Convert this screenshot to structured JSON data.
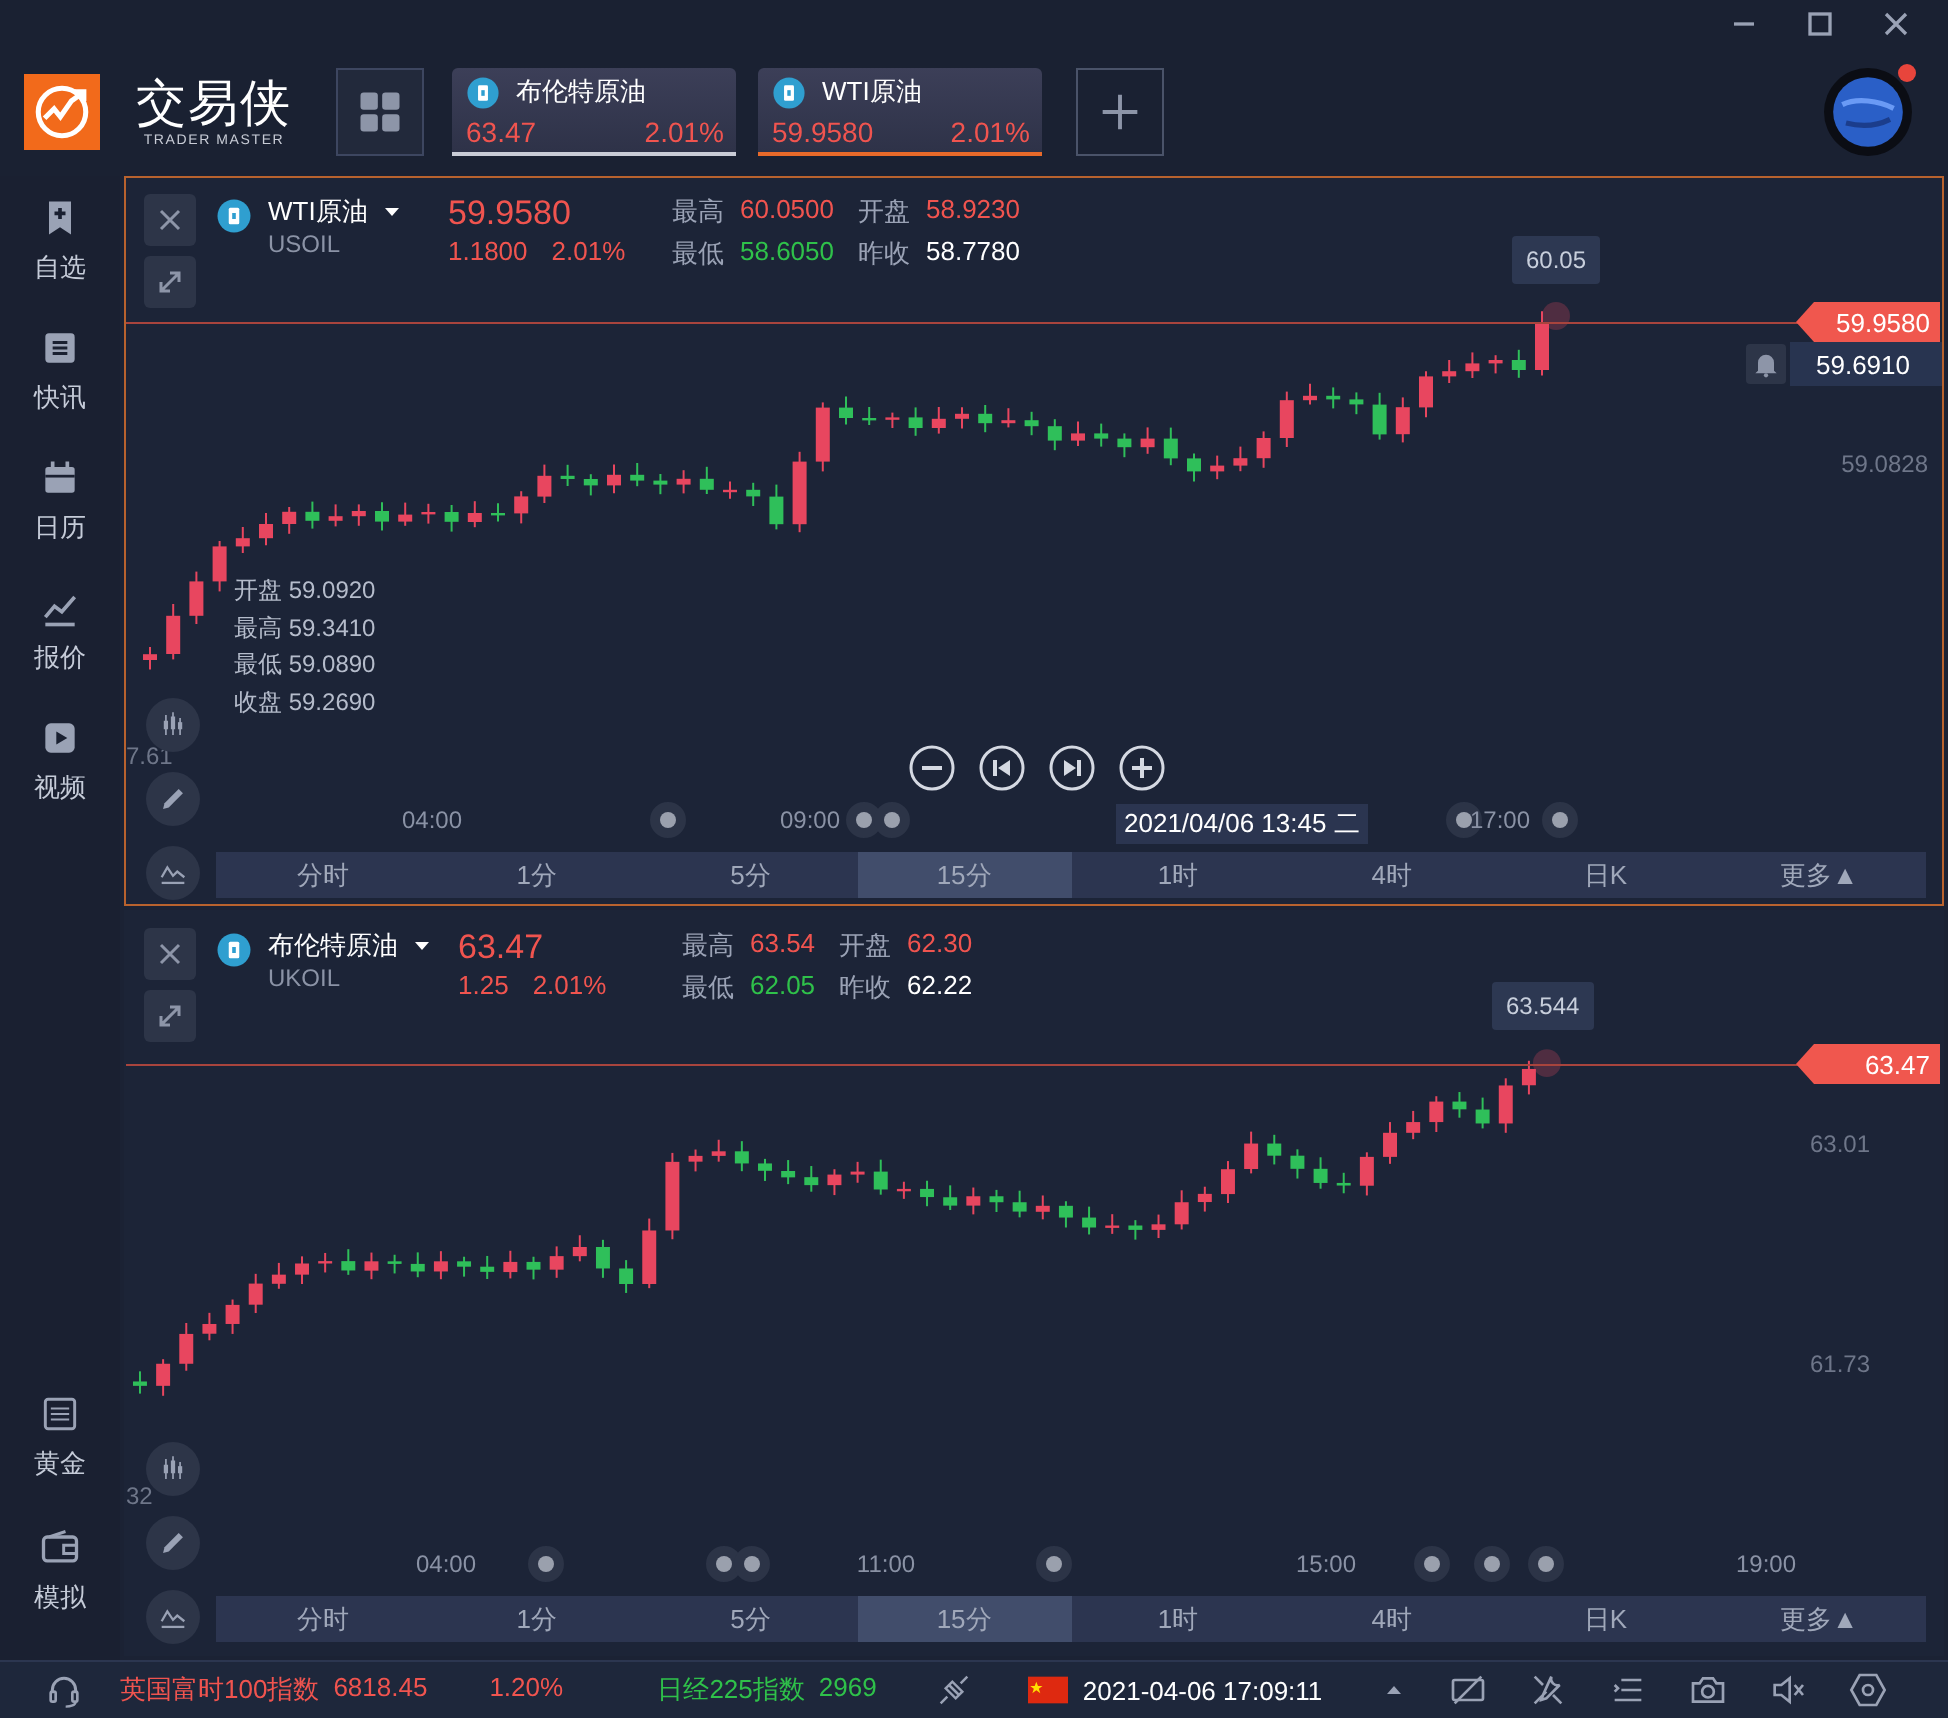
{
  "window_controls": [
    {
      "kind": "minimize"
    },
    {
      "kind": "maximize"
    },
    {
      "kind": "close"
    }
  ],
  "logo": {
    "name": "交易侠",
    "tagline": "TRADER MASTER"
  },
  "quote_tabs": [
    {
      "name": "布伦特原油",
      "price": "63.47",
      "change_pct": "2.01%",
      "selected": false
    },
    {
      "name": "WTI原油",
      "price": "59.9580",
      "change_pct": "2.01%",
      "selected": true
    }
  ],
  "account": {
    "notification": true
  },
  "sidebar": {
    "items": [
      {
        "label": "自选",
        "kind": "watchlist"
      },
      {
        "label": "快讯",
        "kind": "news"
      },
      {
        "label": "日历",
        "kind": "calendar"
      },
      {
        "label": "报价",
        "kind": "quote"
      },
      {
        "label": "视频",
        "kind": "video"
      }
    ],
    "bottom_items": [
      {
        "label": "黄金",
        "kind": "gold"
      },
      {
        "label": "模拟",
        "kind": "wallet"
      }
    ]
  },
  "charts": [
    {
      "name": "WTI原油",
      "symbol": "USOIL",
      "price": "59.9580",
      "change": "1.1800",
      "change_pct": "2.01%",
      "selected": true,
      "stats": [
        {
          "label": "最高",
          "value": "60.0500",
          "color": "#f0544f"
        },
        {
          "label": "开盘",
          "value": "58.9230",
          "color": "#f0544f"
        },
        {
          "label": "最低",
          "value": "58.6050",
          "color": "#2fc14a"
        },
        {
          "label": "昨收",
          "value": "58.7780",
          "color": "#ffffff"
        }
      ],
      "price_tag": "59.9580",
      "high_marker": "60.05",
      "alert_price": "59.6910",
      "y_labels": [
        "59.0828"
      ],
      "left_label": "7.61",
      "ohlc": [
        "开盘 59.0920",
        "最高 59.3410",
        "最低 59.0890",
        "收盘 59.2690"
      ],
      "drawing_tools": [
        {
          "kind": "candles"
        },
        {
          "kind": "pencil"
        },
        {
          "kind": "indicator"
        }
      ],
      "playback_controls": [
        {
          "kind": "zoom-out"
        },
        {
          "kind": "prev"
        },
        {
          "kind": "next"
        },
        {
          "kind": "zoom-in"
        }
      ],
      "time_labels": [
        "04:00",
        "09:00",
        "17:00"
      ],
      "crosshair_time": "2021/04/06 13:45 二",
      "intervals": [
        {
          "label": "分时",
          "selected": false
        },
        {
          "label": "1分",
          "selected": false
        },
        {
          "label": "5分",
          "selected": false
        },
        {
          "label": "15分",
          "selected": true
        },
        {
          "label": "1时",
          "selected": false
        },
        {
          "label": "4时",
          "selected": false
        },
        {
          "label": "日K",
          "selected": false
        },
        {
          "label": "更多▲",
          "selected": false
        }
      ]
    },
    {
      "name": "布伦特原油",
      "symbol": "UKOIL",
      "price": "63.47",
      "change": "1.25",
      "change_pct": "2.01%",
      "selected": false,
      "stats": [
        {
          "label": "最高",
          "value": "63.54",
          "color": "#f0544f"
        },
        {
          "label": "开盘",
          "value": "62.30",
          "color": "#f0544f"
        },
        {
          "label": "最低",
          "value": "62.05",
          "color": "#2fc14a"
        },
        {
          "label": "昨收",
          "value": "62.22",
          "color": "#ffffff"
        }
      ],
      "price_tag": "63.47",
      "high_marker": "63.544",
      "y_labels": [
        "63.01",
        "61.73"
      ],
      "left_label": "32",
      "drawing_tools": [
        {
          "kind": "candles"
        },
        {
          "kind": "pencil"
        },
        {
          "kind": "indicator"
        }
      ],
      "time_labels": [
        "04:00",
        "11:00",
        "15:00",
        "19:00"
      ],
      "intervals": [
        {
          "label": "分时",
          "selected": false
        },
        {
          "label": "1分",
          "selected": false
        },
        {
          "label": "5分",
          "selected": false
        },
        {
          "label": "15分",
          "selected": true
        },
        {
          "label": "1时",
          "selected": false
        },
        {
          "label": "4时",
          "selected": false
        },
        {
          "label": "日K",
          "selected": false
        },
        {
          "label": "更多▲",
          "selected": false
        }
      ]
    }
  ],
  "status_bar": {
    "tickers": [
      {
        "name": "英国富时100指数",
        "value": "6818.45",
        "change": "1.20%",
        "color": "#f0544f"
      },
      {
        "name": "日经225指数",
        "value": "2969",
        "color": "#2fc14a"
      }
    ],
    "datetime": "2021-04-06 17:09:11",
    "tools": [
      {
        "kind": "screen-off"
      },
      {
        "kind": "tools"
      },
      {
        "kind": "list"
      },
      {
        "kind": "camera"
      },
      {
        "kind": "mute"
      },
      {
        "kind": "settings"
      }
    ]
  }
}
